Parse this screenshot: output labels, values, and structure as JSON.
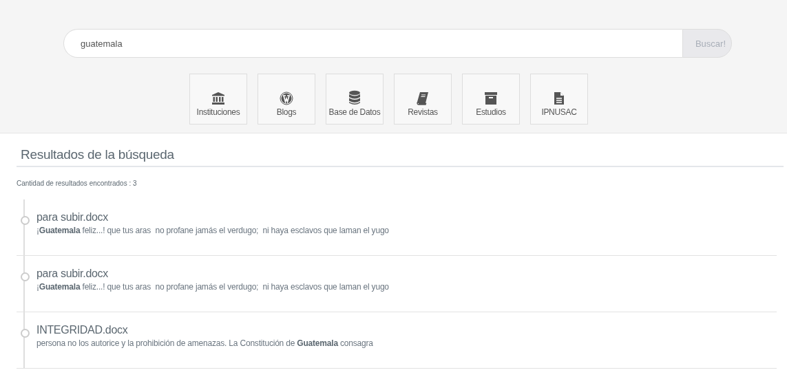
{
  "search": {
    "value": "guatemala",
    "button": "Buscar!"
  },
  "categories": [
    {
      "label": "Instituciones",
      "kind": "bank"
    },
    {
      "label": "Blogs",
      "kind": "wordpress"
    },
    {
      "label": "Base de Datos",
      "kind": "database"
    },
    {
      "label": "Revistas",
      "kind": "book"
    },
    {
      "label": "Estudios",
      "kind": "archive"
    },
    {
      "label": "IPNUSAC",
      "kind": "file"
    }
  ],
  "results_heading": "Resultados de la búsqueda",
  "results_count": "Cantidad de resultados encontrados : 3",
  "results": [
    {
      "title": "para subir.docx",
      "snippet": "¡**Guatemala** feliz...! que tus aras  no profane jamás el verdugo;  ni haya esclavos que laman el yugo"
    },
    {
      "title": "para subir.docx",
      "snippet": "¡**Guatemala** feliz...! que tus aras  no profane jamás el verdugo;  ni haya esclavos que laman el yugo"
    },
    {
      "title": "INTEGRIDAD.docx",
      "snippet": "persona no los autorice y la prohibición de amenazas. La Constitución de **Guatemala** consagra"
    }
  ]
}
